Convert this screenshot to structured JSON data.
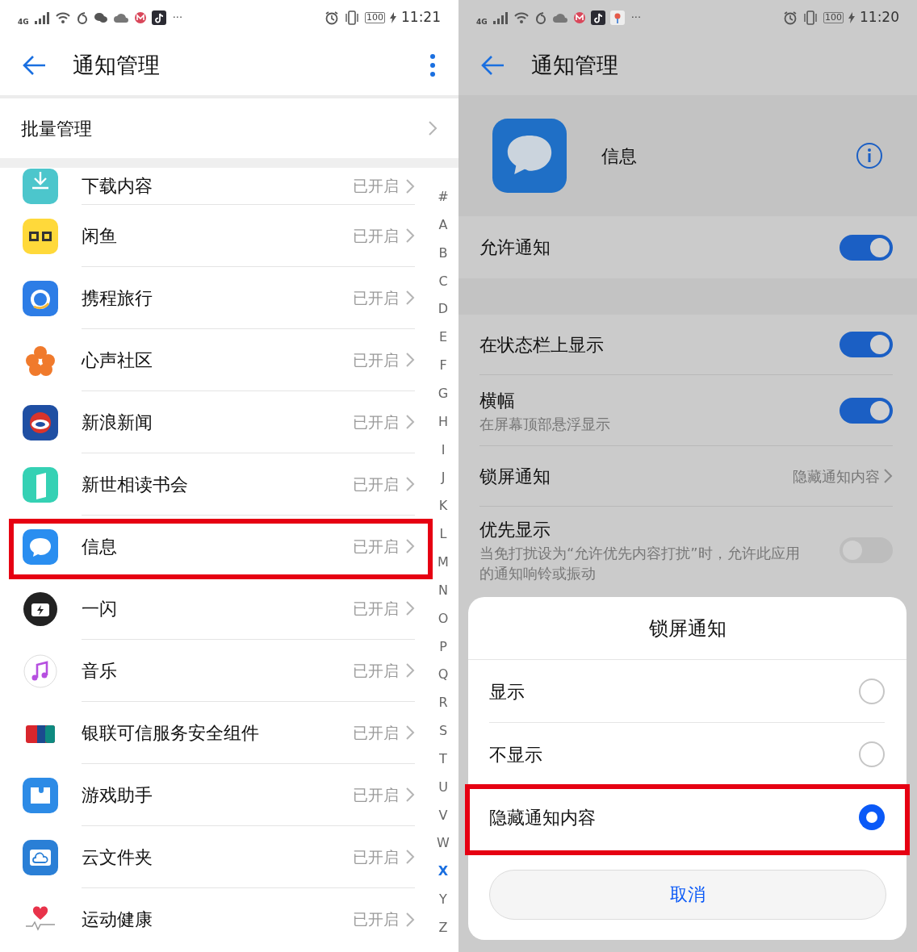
{
  "left_screen": {
    "status_bar": {
      "network": "4G",
      "battery": "100",
      "time": "11:21",
      "more": "···"
    },
    "header": {
      "title": "通知管理"
    },
    "batch_row": {
      "label": "批量管理"
    },
    "apps": [
      {
        "name": "下载内容",
        "status": "已开启",
        "kind": "download",
        "highlighted": false
      },
      {
        "name": "闲鱼",
        "status": "已开启",
        "kind": "xianyu",
        "highlighted": false
      },
      {
        "name": "携程旅行",
        "status": "已开启",
        "kind": "dolphin",
        "highlighted": false
      },
      {
        "name": "心声社区",
        "status": "已开启",
        "kind": "flower",
        "highlighted": false
      },
      {
        "name": "新浪新闻",
        "status": "已开启",
        "kind": "sina",
        "highlighted": false
      },
      {
        "name": "新世相读书会",
        "status": "已开启",
        "kind": "book",
        "highlighted": false
      },
      {
        "name": "信息",
        "status": "已开启",
        "kind": "message",
        "highlighted": true
      },
      {
        "name": "一闪",
        "status": "已开启",
        "kind": "camera",
        "highlighted": false
      },
      {
        "name": "音乐",
        "status": "已开启",
        "kind": "music",
        "highlighted": false
      },
      {
        "name": "银联可信服务安全组件",
        "status": "已开启",
        "kind": "card",
        "highlighted": false
      },
      {
        "name": "游戏助手",
        "status": "已开启",
        "kind": "puzzle",
        "highlighted": false
      },
      {
        "name": "云文件夹",
        "status": "已开启",
        "kind": "cloud",
        "highlighted": false
      },
      {
        "name": "运动健康",
        "status": "已开启",
        "kind": "heart",
        "highlighted": false
      }
    ],
    "index": [
      {
        "letter": "#",
        "selected": false
      },
      {
        "letter": "A",
        "selected": false
      },
      {
        "letter": "B",
        "selected": false
      },
      {
        "letter": "C",
        "selected": false
      },
      {
        "letter": "D",
        "selected": false
      },
      {
        "letter": "E",
        "selected": false
      },
      {
        "letter": "F",
        "selected": false
      },
      {
        "letter": "G",
        "selected": false
      },
      {
        "letter": "H",
        "selected": false
      },
      {
        "letter": "I",
        "selected": false
      },
      {
        "letter": "J",
        "selected": false
      },
      {
        "letter": "K",
        "selected": false
      },
      {
        "letter": "L",
        "selected": false
      },
      {
        "letter": "M",
        "selected": false
      },
      {
        "letter": "N",
        "selected": false
      },
      {
        "letter": "O",
        "selected": false
      },
      {
        "letter": "P",
        "selected": false
      },
      {
        "letter": "Q",
        "selected": false
      },
      {
        "letter": "R",
        "selected": false
      },
      {
        "letter": "S",
        "selected": false
      },
      {
        "letter": "T",
        "selected": false
      },
      {
        "letter": "U",
        "selected": false
      },
      {
        "letter": "V",
        "selected": false
      },
      {
        "letter": "W",
        "selected": false
      },
      {
        "letter": "X",
        "selected": true
      },
      {
        "letter": "Y",
        "selected": false
      },
      {
        "letter": "Z",
        "selected": false
      }
    ]
  },
  "right_screen": {
    "status_bar": {
      "network": "4G",
      "battery": "100",
      "time": "11:20",
      "more": "···"
    },
    "header": {
      "title": "通知管理"
    },
    "app": {
      "name": "信息"
    },
    "allow_row": {
      "label": "允许通知",
      "on": true
    },
    "settings": [
      {
        "kind": "toggle",
        "label": "在状态栏上显示",
        "on": true
      },
      {
        "kind": "toggle",
        "label": "横幅",
        "subtitle": "在屏幕顶部悬浮显示",
        "on": true
      },
      {
        "kind": "link",
        "label": "锁屏通知",
        "value": "隐藏通知内容"
      },
      {
        "kind": "toggle",
        "label": "优先显示",
        "subtitle": "当免打扰设为“允许优先内容打扰”时，允许此应用的通知响铃或振动",
        "on": false
      }
    ],
    "sheet": {
      "title": "锁屏通知",
      "options": [
        {
          "label": "显示",
          "selected": false,
          "highlighted": false
        },
        {
          "label": "不显示",
          "selected": false,
          "highlighted": false
        },
        {
          "label": "隐藏通知内容",
          "selected": true,
          "highlighted": true
        }
      ],
      "cancel": "取消"
    }
  }
}
